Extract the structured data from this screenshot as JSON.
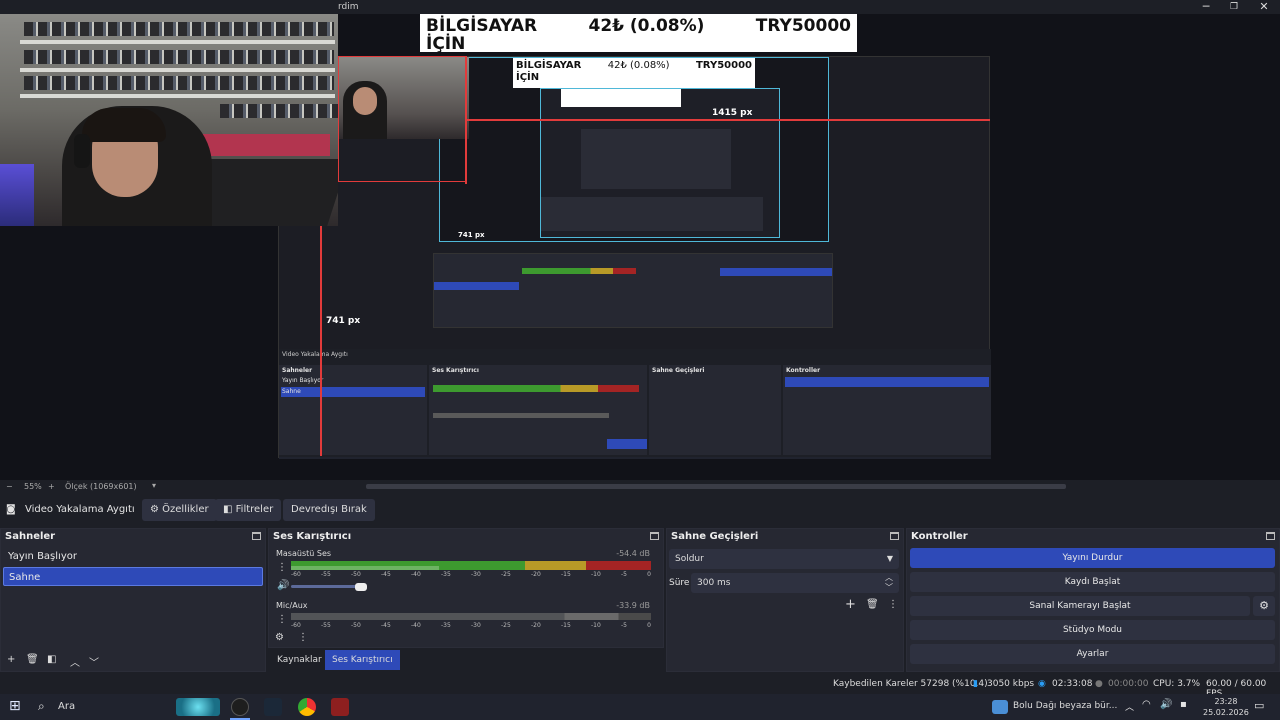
{
  "window": {
    "title_fragment": "rdim",
    "minimize": "─",
    "restore": "❐",
    "close": "✕"
  },
  "overlay": {
    "product": "BİLGİSAYAR İÇİN",
    "product_line1": "BİLGİSAYAR",
    "product_line2": "İÇİN",
    "change": "42₺ (0.08%)",
    "price": "TRY50000",
    "inner_change": "42₺ (0.08%)",
    "measure_h": "1415 px",
    "measure_v": "741 px",
    "measure_v2": "741 px"
  },
  "zoom": {
    "minus": "−",
    "percent": "55%",
    "plus": "+",
    "scale_label": "Ölçek (1069x601)"
  },
  "source_toolbar": {
    "source_name": "Video Yakalama Aygıtı",
    "properties": "Özellikler",
    "filters": "Filtreler",
    "deactivate": "Devredışı Bırak"
  },
  "scenes": {
    "title": "Sahneler",
    "items": [
      "Yayın Başlıyor",
      "Sahne"
    ],
    "selected_index": 1
  },
  "mixer": {
    "title": "Ses Karıştırıcı",
    "channels": [
      {
        "name": "Masaüstü Ses",
        "db": "-54.4 dB",
        "level": 0.41
      },
      {
        "name": "Mic/Aux",
        "db": "-33.9 dB",
        "level": 0.0
      }
    ],
    "ticks": [
      "-60",
      "-55",
      "-50",
      "-45",
      "-40",
      "-35",
      "-30",
      "-25",
      "-20",
      "-15",
      "-10",
      "-5",
      "0"
    ],
    "tabs": [
      "Kaynaklar",
      "Ses Karıştırıcı"
    ],
    "selected_tab": 1
  },
  "transitions": {
    "title": "Sahne Geçişleri",
    "transition": "Soldur",
    "duration_label": "Süre",
    "duration_value": "300 ms"
  },
  "controls": {
    "title": "Kontroller",
    "stop_stream": "Yayını Durdur",
    "start_record": "Kaydı Başlat",
    "virtual_cam": "Sanal Kamerayı Başlat",
    "studio_mode": "Stüdyo Modu",
    "settings": "Ayarlar"
  },
  "status": {
    "dropped": "Kaybedilen Kareler 57298 (%10.4)",
    "bitrate": "3050 kbps",
    "stream_time": "02:33:08",
    "record_time": "00:00:00",
    "cpu": "CPU: 3.7%",
    "fps": "60.00 / 60.00 FPS"
  },
  "taskbar": {
    "search": "Ara",
    "news": "Bolu Dağı beyaza bür...",
    "time": "23:28",
    "date": "25.02.2026"
  },
  "colors": {
    "accent": "#2e4ab8",
    "meter_green": "#3d9a2f",
    "meter_yellow": "#b89a27",
    "meter_red": "#a42424"
  }
}
